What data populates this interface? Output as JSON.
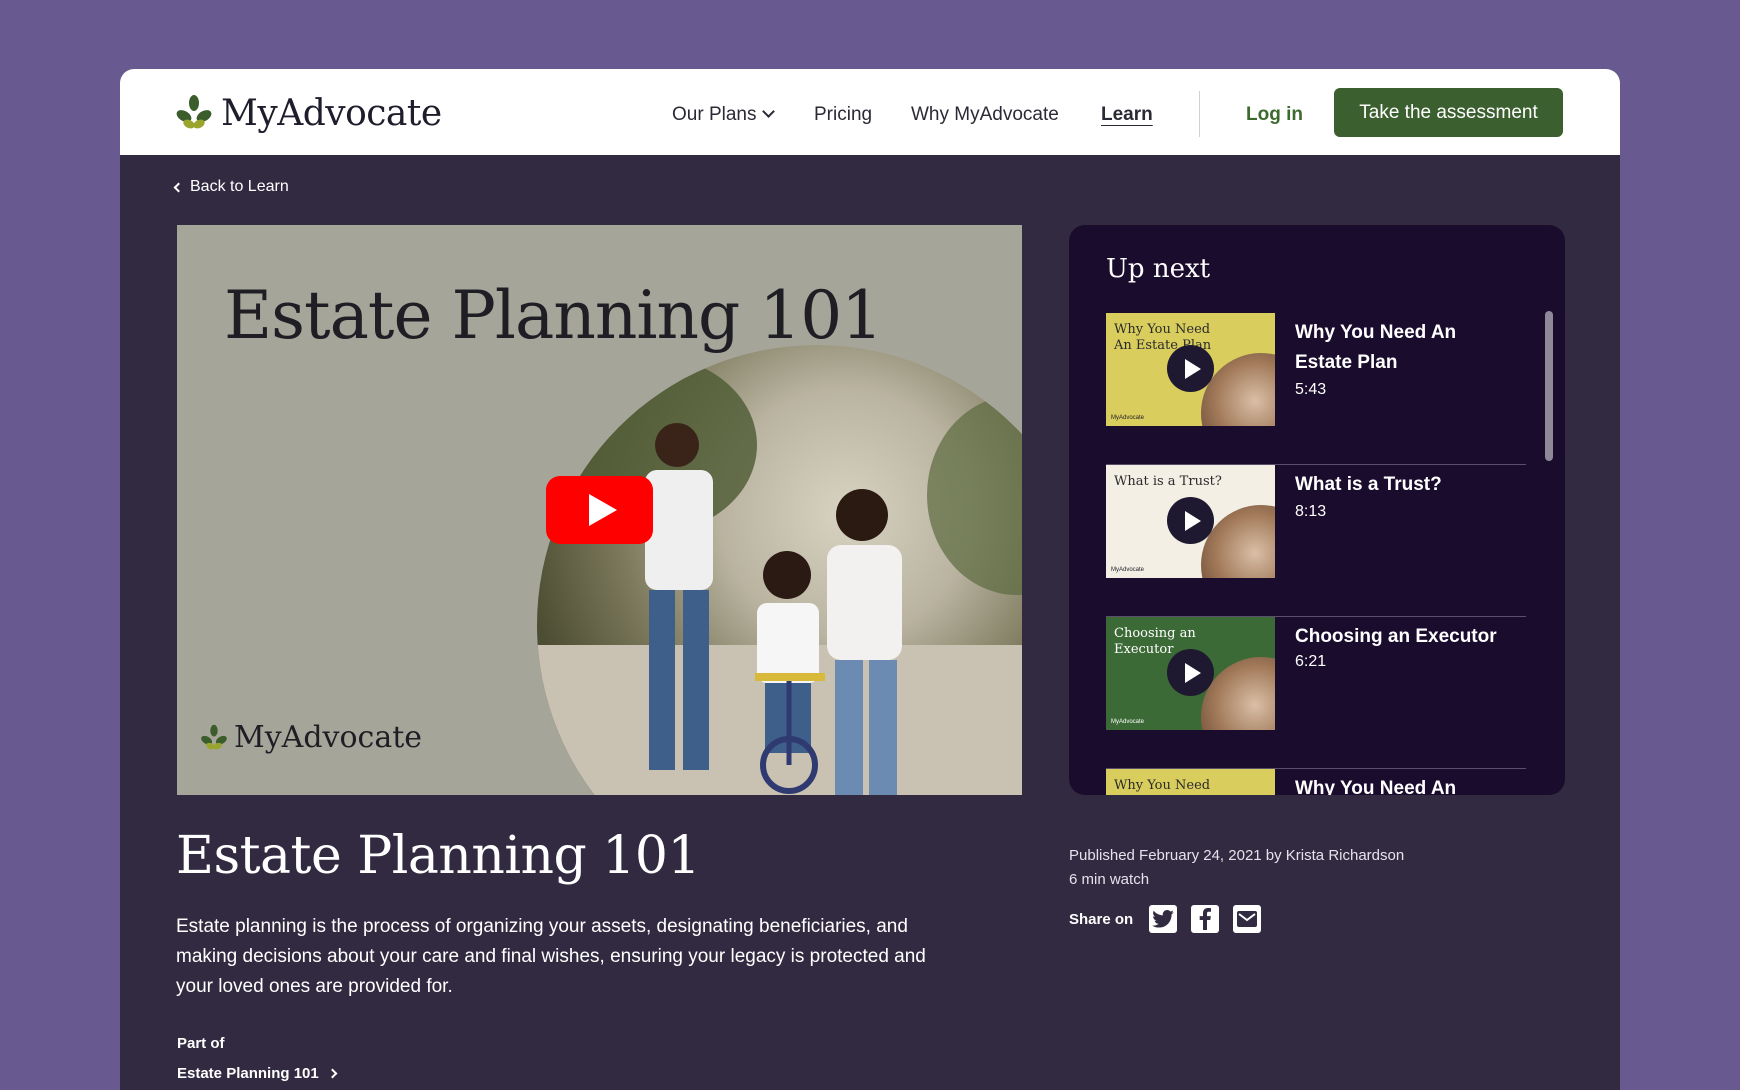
{
  "header": {
    "logo_text": "MyAdvocate",
    "nav": [
      {
        "label": "Our Plans"
      },
      {
        "label": "Pricing"
      },
      {
        "label": "Why MyAdvocate"
      },
      {
        "label": "Learn"
      }
    ],
    "login_label": "Log in",
    "cta_label": "Take the assessment"
  },
  "back_link": "Back to Learn",
  "video": {
    "title": "Estate Planning 101",
    "logo_text": "MyAdvocate"
  },
  "up_next": {
    "title": "Up next",
    "items": [
      {
        "thumb_text": "Why You Need An Estate Plan",
        "thumb_logo": "MyAdvocate",
        "thumb_bg": "#d9cd5e",
        "thumb_color": "#2a2a2a",
        "title": "Why You Need An Estate Plan",
        "duration": "5:43"
      },
      {
        "thumb_text": "What is a Trust?",
        "thumb_logo": "MyAdvocate",
        "thumb_bg": "#f3efe5",
        "thumb_color": "#2a2a2a",
        "title": "What is a Trust?",
        "duration": "8:13"
      },
      {
        "thumb_text": "Choosing an Executor",
        "thumb_logo": "MyAdvocate",
        "thumb_bg": "#3c6a36",
        "thumb_color": "#ffffff",
        "title": "Choosing an Executor",
        "duration": "6:21"
      },
      {
        "thumb_text": "Why You Need An",
        "thumb_bg": "#d9cd5e",
        "thumb_color": "#2a2a2a",
        "title": "Why You Need An"
      }
    ]
  },
  "article": {
    "title": "Estate Planning 101",
    "description": "Estate planning is the process of organizing your assets, designating beneficiaries, and making decisions about your care and final wishes, ensuring your legacy is protected and your loved ones are provided for.",
    "part_of_label": "Part of",
    "part_of_link": "Estate Planning 101"
  },
  "meta": {
    "published": "Published February 24, 2021 by Krista Richardson",
    "watch_time": "6 min watch",
    "share_label": "Share on"
  },
  "colors": {
    "page_bg": "#685a90",
    "content_bg": "#322a40",
    "panel_bg": "#1a0c2d",
    "brand_green": "#3c5f2f",
    "youtube_red": "#ff0000"
  }
}
